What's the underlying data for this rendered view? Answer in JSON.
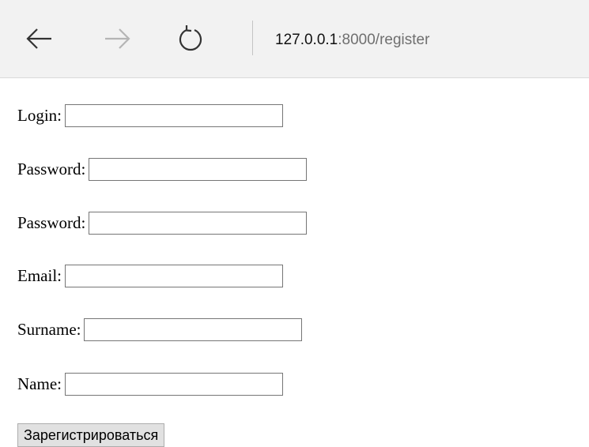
{
  "browser": {
    "address_host": "127.0.0.1",
    "address_rest": ":8000/register",
    "icons": {
      "back": "back-arrow-icon",
      "forward": "forward-arrow-icon",
      "reload": "reload-icon"
    }
  },
  "form": {
    "fields": [
      {
        "label": "Login:",
        "value": ""
      },
      {
        "label": "Password:",
        "value": ""
      },
      {
        "label": "Password:",
        "value": ""
      },
      {
        "label": "Email:",
        "value": ""
      },
      {
        "label": "Surname:",
        "value": ""
      },
      {
        "label": "Name:",
        "value": ""
      }
    ],
    "submit_label": "Зарегистрироваться"
  }
}
